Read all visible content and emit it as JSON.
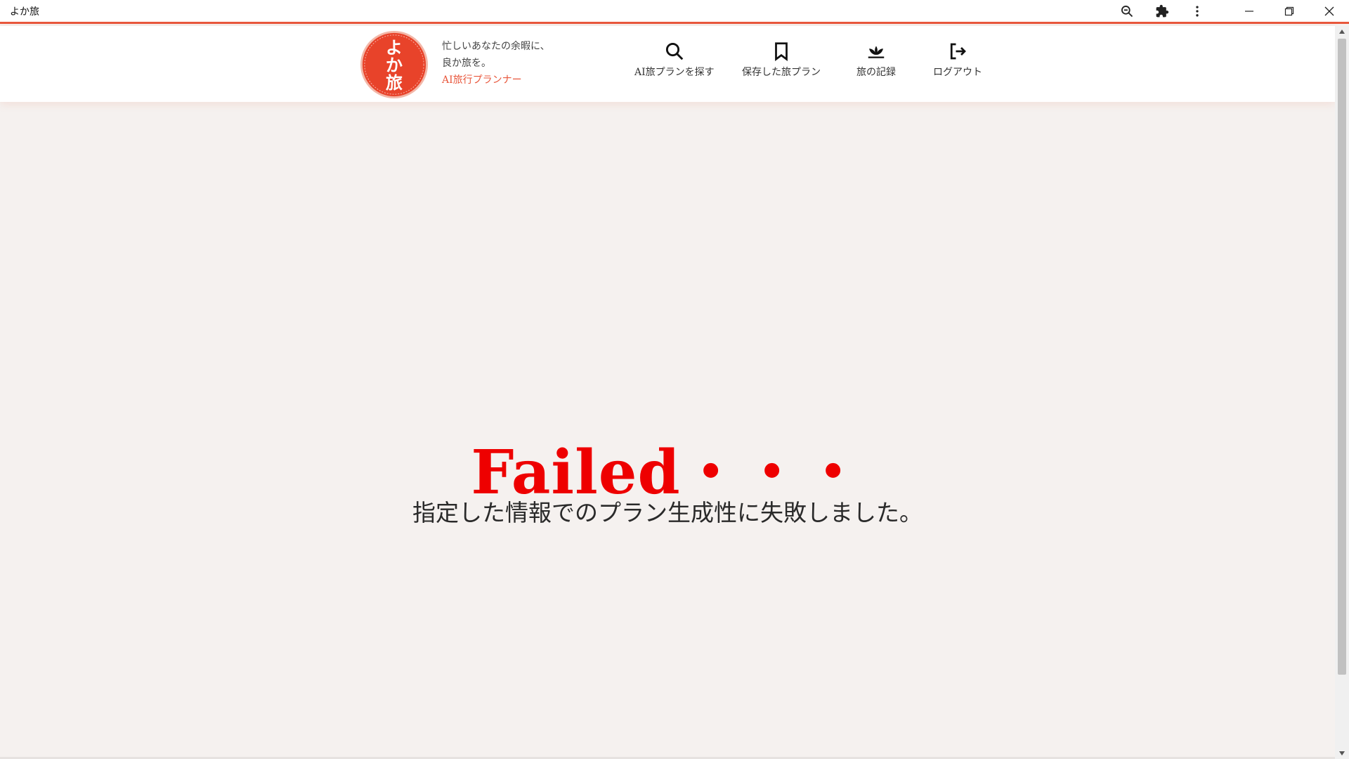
{
  "window": {
    "title": "よか旅"
  },
  "toolbar": {
    "zoom_icon": "zoom-out-icon",
    "extensions_icon": "puzzle-icon",
    "menu_icon": "more-vert-icon"
  },
  "header": {
    "logo": {
      "line1": "よ",
      "line2": "か",
      "line3": "旅",
      "color": "#e8432a"
    },
    "tagline": {
      "line1": "忙しいあなたの余暇に、",
      "line2": "良か旅を。",
      "line3": "AI旅行プランナー"
    },
    "nav": [
      {
        "label": "AI旅プランを探す",
        "icon": "search-icon"
      },
      {
        "label": "保存した旅プラン",
        "icon": "bookmark-icon"
      },
      {
        "label": "旅の記録",
        "icon": "lotus-icon"
      },
      {
        "label": "ログアウト",
        "icon": "logout-icon"
      }
    ]
  },
  "main": {
    "title": "Failed・・・",
    "message": "指定した情報でのプラン生成性に失敗しました。"
  },
  "colors": {
    "accent": "#e8573c",
    "error": "#ee0000",
    "background": "#f5f1ef"
  }
}
